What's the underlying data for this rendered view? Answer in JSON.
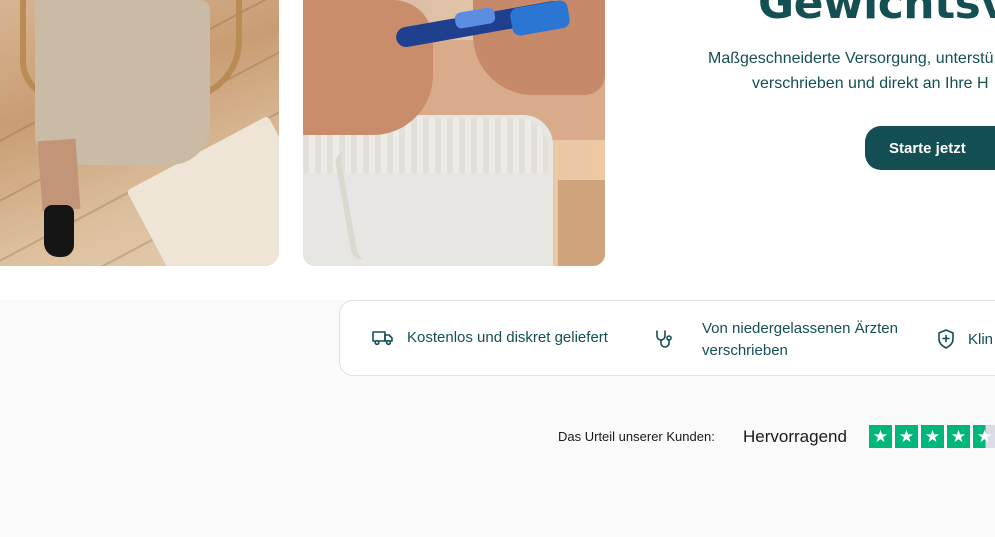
{
  "hero": {
    "title": "Gewichtsve",
    "subtitle_line1": "Maßgeschneiderte Versorgung, unterstü",
    "subtitle_line2": "verschrieben und direkt an Ihre H",
    "cta_label": "Starte jetzt"
  },
  "features": [
    {
      "icon": "truck-icon",
      "label": "Kostenlos und diskret geliefert"
    },
    {
      "icon": "stethoscope-icon",
      "label_line1": "Von niedergelassenen Ärzten",
      "label_line2": "verschrieben"
    },
    {
      "icon": "shield-plus-icon",
      "label": "Klin"
    }
  ],
  "trustpilot": {
    "label": "Das Urteil unserer Kunden:",
    "rating_text": "Hervorragend",
    "stars": 4.5,
    "star_glyph": "★"
  },
  "colors": {
    "brand": "#134f52",
    "text": "#144f53",
    "star_green": "#00b67a"
  }
}
